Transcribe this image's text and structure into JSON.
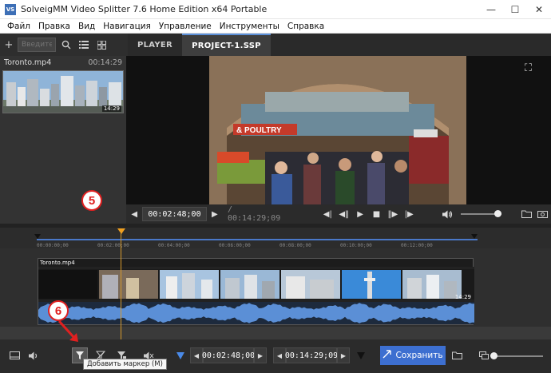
{
  "window": {
    "title": "SolveigMM Video Splitter 7.6 Home Edition x64 Portable",
    "app_icon_text": "VS",
    "controls": [
      "—",
      "☐",
      "✕"
    ]
  },
  "menu": [
    "Файл",
    "Правка",
    "Вид",
    "Навигация",
    "Управление",
    "Инструменты",
    "Справка"
  ],
  "library": {
    "search_placeholder": "Введите н",
    "file_name": "Toronto.mp4",
    "file_duration": "00:14:29",
    "thumb_duration": "14:29"
  },
  "tabs": [
    {
      "label": "PLAYER",
      "active": false
    },
    {
      "label": "PROJECT-1.SSP",
      "active": true
    }
  ],
  "player": {
    "sign_text": "& POULTRY",
    "current_time": "00:02:48;00",
    "total_time": "/ 00:14:29;09",
    "volume": 0.9
  },
  "timeline": {
    "ticks": [
      "00:00:00;00",
      "00:02:00;00",
      "00:04:00;00",
      "00:06:00;00",
      "00:08:00;00",
      "00:10:00;00",
      "00:12:00;00"
    ],
    "clip_name": "Toronto.mp4",
    "clip_duration": "14:29"
  },
  "annotations": {
    "badge_5": "5",
    "badge_6": "6"
  },
  "bottom": {
    "marker_in_time": "00:02:48;00",
    "marker_out_time": "00:14:29;09",
    "save_label": "Сохранить",
    "tooltip": "Добавить маркер (M)"
  },
  "colors": {
    "accent": "#3d6fd0",
    "playhead": "#f0a020",
    "badge": "#e02020"
  }
}
